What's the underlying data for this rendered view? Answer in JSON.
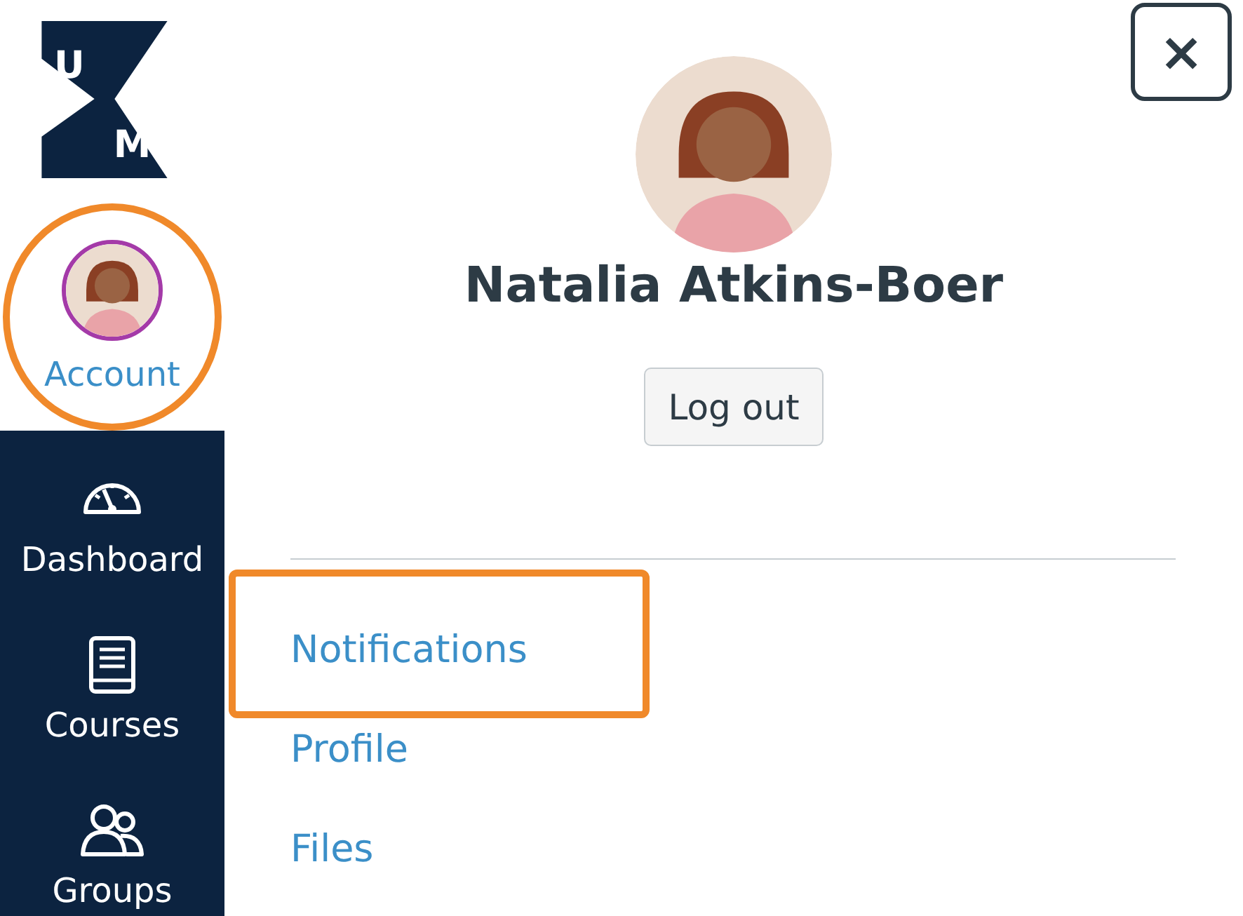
{
  "logo": {
    "letters": [
      "U",
      "M"
    ]
  },
  "account": {
    "label": "Account",
    "highlighted": true
  },
  "nav": [
    {
      "kind": "dashboard",
      "label": "Dashboard"
    },
    {
      "kind": "courses",
      "label": "Courses"
    },
    {
      "kind": "groups",
      "label": "Groups"
    }
  ],
  "close_button": {
    "label": "×"
  },
  "user": {
    "name": "Natalia Atkins-Boer"
  },
  "logout_button": {
    "label": "Log out"
  },
  "links": [
    {
      "label": "Notifications",
      "highlighted": true
    },
    {
      "label": "Profile",
      "highlighted": false
    },
    {
      "label": "Files",
      "highlighted": false
    }
  ]
}
